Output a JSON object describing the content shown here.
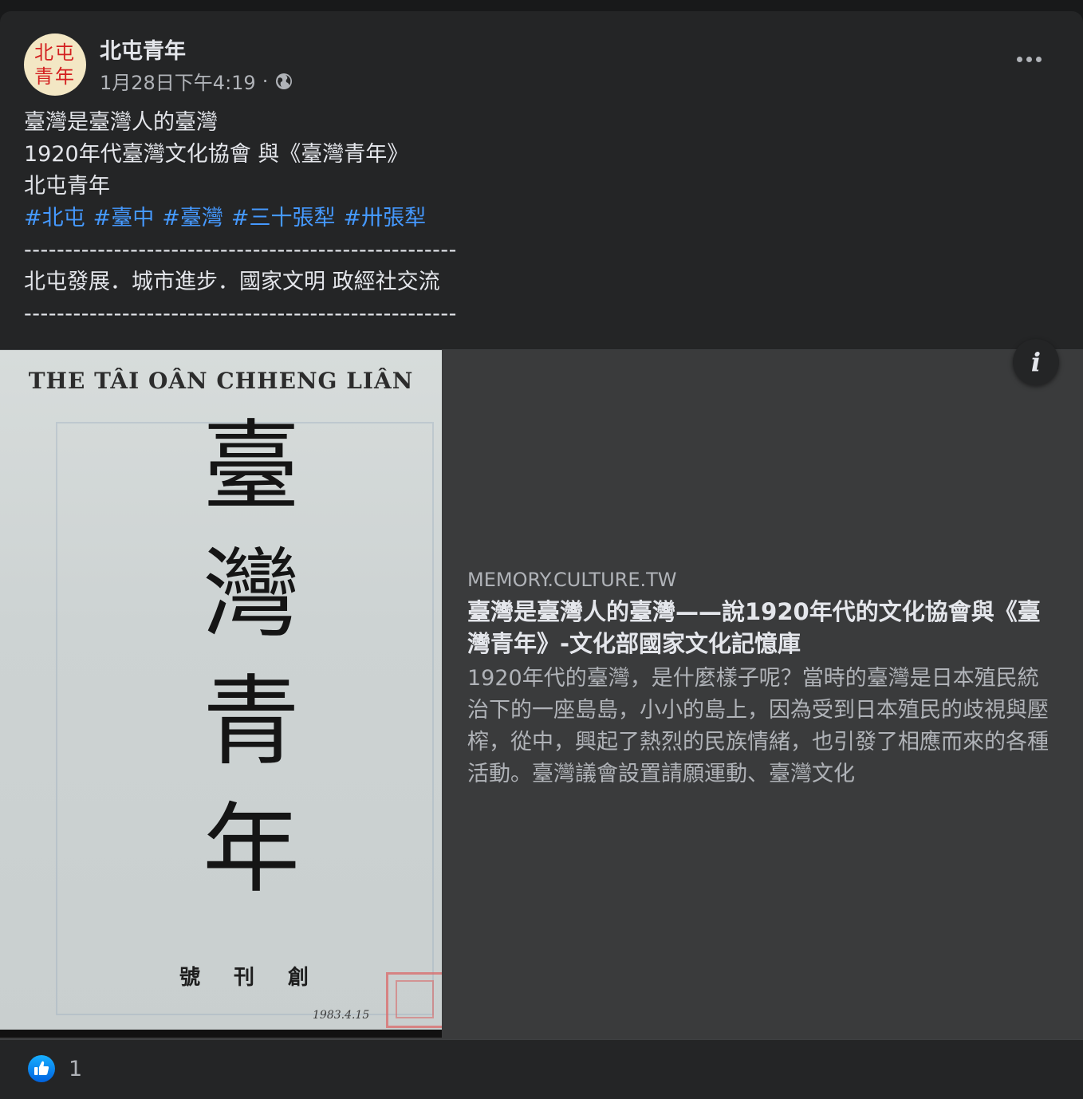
{
  "post": {
    "page_name": "北屯青年",
    "avatar_line1": "北屯",
    "avatar_line2": "青年",
    "timestamp": "1月28日下午4:19",
    "separator": "·",
    "privacy_icon": "globe-icon",
    "more_icon": "more-horizontal-icon",
    "text_lines": [
      "臺灣是臺灣人的臺灣",
      "1920年代臺灣文化協會 與《臺灣青年》",
      "北屯青年"
    ],
    "hashtags": [
      "#北屯",
      "#臺中",
      "#臺灣",
      "#三十張犁",
      "#卅張犁"
    ],
    "divider": "-----------------------------------------------------",
    "slogan": "北屯發展．城市進步．國家文明 政經社交流"
  },
  "link_preview": {
    "thumbnail": {
      "english_title": "THE TÂI OÂN CHHENG LIÂN",
      "title_chars": [
        "臺",
        "灣",
        "青",
        "年"
      ],
      "issue_label": "號刊創",
      "handwritten_date": "1983.4.15"
    },
    "info_icon": "info-icon",
    "domain": "MEMORY.CULTURE.TW",
    "title": "臺灣是臺灣人的臺灣——說1920年代的文化協會與《臺灣青年》-文化部國家文化記憶庫",
    "description": "1920年代的臺灣，是什麼樣子呢？當時的臺灣是日本殖民統治下的一座島島，小小的島上，因為受到日本殖民的歧視與壓榨，從中，興起了熱烈的民族情緒，也引發了相應而來的各種活動。臺灣議會設置請願運動、臺灣文化"
  },
  "reactions": {
    "icon": "like-icon",
    "count": "1"
  },
  "colors": {
    "background": "#18191a",
    "card": "#242526",
    "preview": "#3a3b3c",
    "text_primary": "#e4e6eb",
    "text_secondary": "#b0b3b8",
    "hashtag": "#4599ff",
    "like_blue": "#1877f2"
  }
}
